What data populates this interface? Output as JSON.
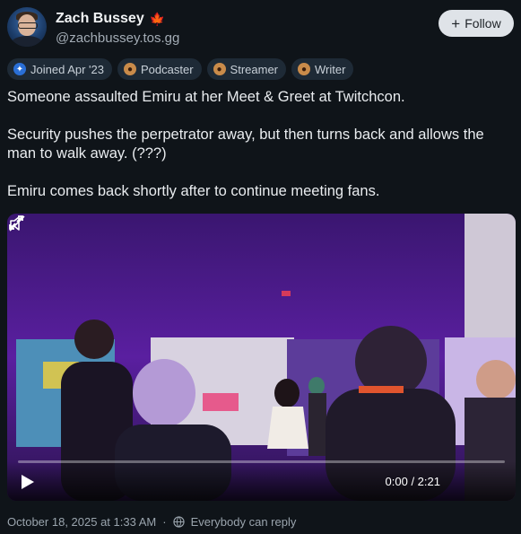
{
  "author": {
    "display_name": "Zach Bussey",
    "handle": "@zachbussey.tos.gg",
    "flag_icon": "maple-leaf-icon"
  },
  "follow_button": {
    "label": "Follow",
    "icon": "plus-icon"
  },
  "badges": [
    {
      "label": "Joined Apr '23",
      "icon": "joined-icon"
    },
    {
      "label": "Podcaster",
      "icon": "avatar-badge-icon"
    },
    {
      "label": "Streamer",
      "icon": "avatar-badge-icon"
    },
    {
      "label": "Writer",
      "icon": "avatar-badge-icon"
    }
  ],
  "post": {
    "paragraphs": [
      "Someone assaulted Emiru at her Meet & Greet at Twitchcon.",
      "Security pushes the perpetrator away, but then turns back and allows the man to walk away. (???)",
      "Emiru comes back shortly after to continue meeting fans."
    ]
  },
  "video": {
    "time_display": "0:00 / 2:21",
    "progress": 0,
    "muted": true
  },
  "footer": {
    "timestamp": "October 18, 2025 at 1:33 AM",
    "reply_setting": "Everybody can reply"
  },
  "colors": {
    "background": "#0f1419",
    "follow_button_bg": "#dfe3e8",
    "badge_bg": "#1e2a36",
    "video_tint": "#5a1fa0"
  }
}
